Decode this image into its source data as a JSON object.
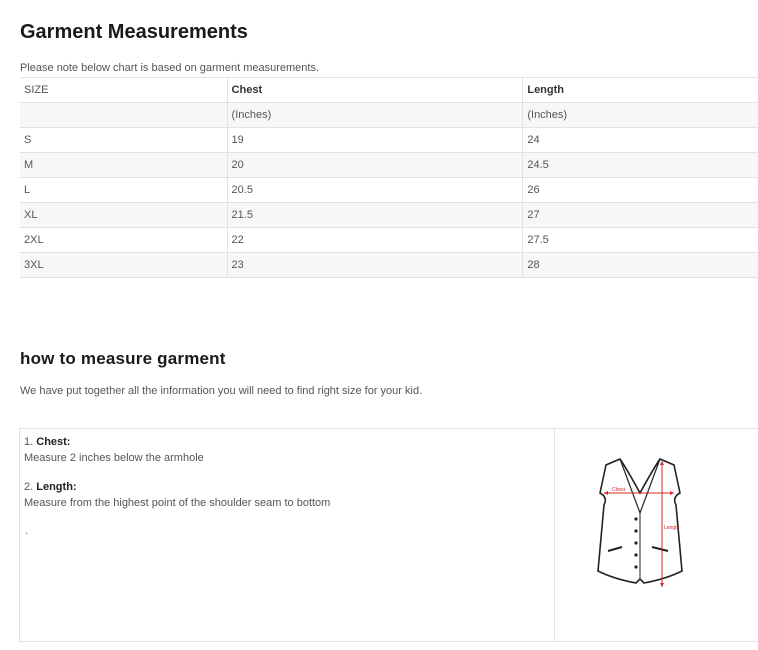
{
  "section1": {
    "title": "Garment Measurements",
    "note": "Please note below chart is based on garment measurements."
  },
  "size_table": {
    "headers": [
      "SIZE",
      "Chest",
      "Length"
    ],
    "units": [
      "",
      "(Inches)",
      "(Inches)"
    ],
    "rows": [
      [
        "S",
        "19",
        "24"
      ],
      [
        "M",
        "20",
        "24.5"
      ],
      [
        "L",
        "20.5",
        "26"
      ],
      [
        "XL",
        "21.5",
        "27"
      ],
      [
        "2XL",
        "22",
        "27.5"
      ],
      [
        "3XL",
        "23",
        "28"
      ]
    ]
  },
  "section2": {
    "title": "how to measure garment",
    "intro": "We have put together all the information you will need to find right size for your kid."
  },
  "instructions": [
    {
      "number": "1.",
      "label": "Chest:",
      "text": "Measure 2 inches below the armhole"
    },
    {
      "number": "2.",
      "label": "Length:",
      "text": "Measure from the highest point of the shoulder seam to bottom"
    }
  ],
  "trailing_mark": ".",
  "diagram": {
    "chest_label": "Chest",
    "length_label": "Length",
    "accent_color": "#d42a2a"
  }
}
